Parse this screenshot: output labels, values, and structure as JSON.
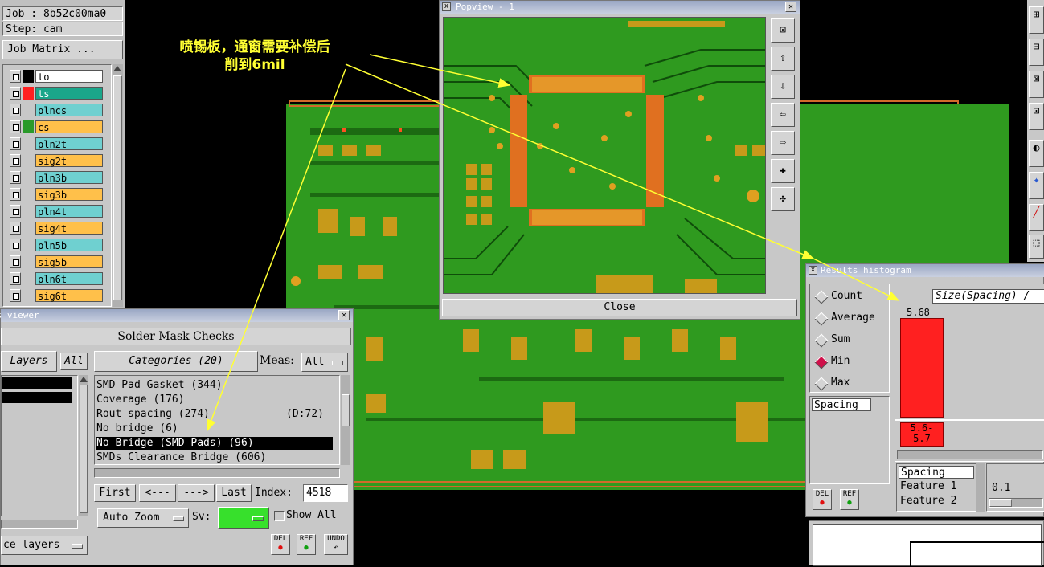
{
  "job_panel": {
    "job": "Job : 8b52c00ma0",
    "step": "Step: cam",
    "job_matrix": "Job Matrix ..."
  },
  "layers": [
    {
      "name": "to",
      "color": "#ffffff",
      "swatch": "#000000"
    },
    {
      "name": "ts",
      "color": "#1aa68a",
      "swatch": "#ff2020"
    },
    {
      "name": "plncs",
      "color": "#6fd0d0",
      "swatch": "#c8c8c8"
    },
    {
      "name": "cs",
      "color": "#ffc04a",
      "swatch": "#2a9a2a"
    },
    {
      "name": "pln2t",
      "color": "#6fd0d0",
      "swatch": "#c8c8c8"
    },
    {
      "name": "sig2t",
      "color": "#ffc04a",
      "swatch": "#c8c8c8"
    },
    {
      "name": "pln3b",
      "color": "#6fd0d0",
      "swatch": "#c8c8c8"
    },
    {
      "name": "sig3b",
      "color": "#ffc04a",
      "swatch": "#c8c8c8"
    },
    {
      "name": "pln4t",
      "color": "#6fd0d0",
      "swatch": "#c8c8c8"
    },
    {
      "name": "sig4t",
      "color": "#ffc04a",
      "swatch": "#c8c8c8"
    },
    {
      "name": "pln5b",
      "color": "#6fd0d0",
      "swatch": "#c8c8c8"
    },
    {
      "name": "sig5b",
      "color": "#ffc04a",
      "swatch": "#c8c8c8"
    },
    {
      "name": "pln6t",
      "color": "#6fd0d0",
      "swatch": "#c8c8c8"
    },
    {
      "name": "sig6t",
      "color": "#ffc04a",
      "swatch": "#c8c8c8"
    }
  ],
  "annotation": {
    "line1": "喷锡板，通窗需要补偿后",
    "line2": "削到6mil"
  },
  "popview": {
    "title": "Popview - 1",
    "close": "Close"
  },
  "results_viewer": {
    "title": "ts viewer",
    "header": "Solder Mask Checks",
    "layers_label": "Layers",
    "layers_all": "All",
    "categories_label": "Categories (20)",
    "meas_label": "Meas:",
    "meas_value": "All",
    "categories": [
      {
        "text": "SMD Pad Gasket (344)",
        "extra": ""
      },
      {
        "text": "Coverage (176)",
        "extra": ""
      },
      {
        "text": "Rout spacing (274)",
        "extra": "(D:72)"
      },
      {
        "text": "No bridge (6)",
        "extra": ""
      },
      {
        "text": "No Bridge (SMD Pads) (96)",
        "extra": ""
      },
      {
        "text": "SMDs Clearance Bridge (606)",
        "extra": ""
      }
    ],
    "first": "First",
    "prev": "<---",
    "next": "--->",
    "last": "Last",
    "index_label": "Index:",
    "index_value": "4518",
    "auto_zoom": "Auto Zoom",
    "sv_label": "Sv:",
    "show_all": "Show All",
    "ce_layers": "ce layers",
    "del": "DEL",
    "ref": "REF",
    "undo": "UNDO"
  },
  "histogram": {
    "title": "Results histogram",
    "options": [
      {
        "label": "Count",
        "selected": false
      },
      {
        "label": "Average",
        "selected": false
      },
      {
        "label": "Sum",
        "selected": false
      },
      {
        "label": "Min",
        "selected": true
      },
      {
        "label": "Max",
        "selected": false
      }
    ],
    "list_item": "Spacing",
    "chart_title": "Size(Spacing) /",
    "bar_value": "5.68",
    "bar_range": "5.6-\n5.7",
    "bar_fraction": 1.0,
    "bottom_list": [
      "Spacing",
      "Feature 1",
      "Feature 2"
    ],
    "scale_value": "0.1",
    "del": "DEL",
    "ref": "REF"
  },
  "colors": {
    "annotation_yellow": "#ffff33",
    "pcb_green": "#2f9a1f",
    "pad_orange": "#e0a020",
    "bar_red": "#ff2020"
  }
}
